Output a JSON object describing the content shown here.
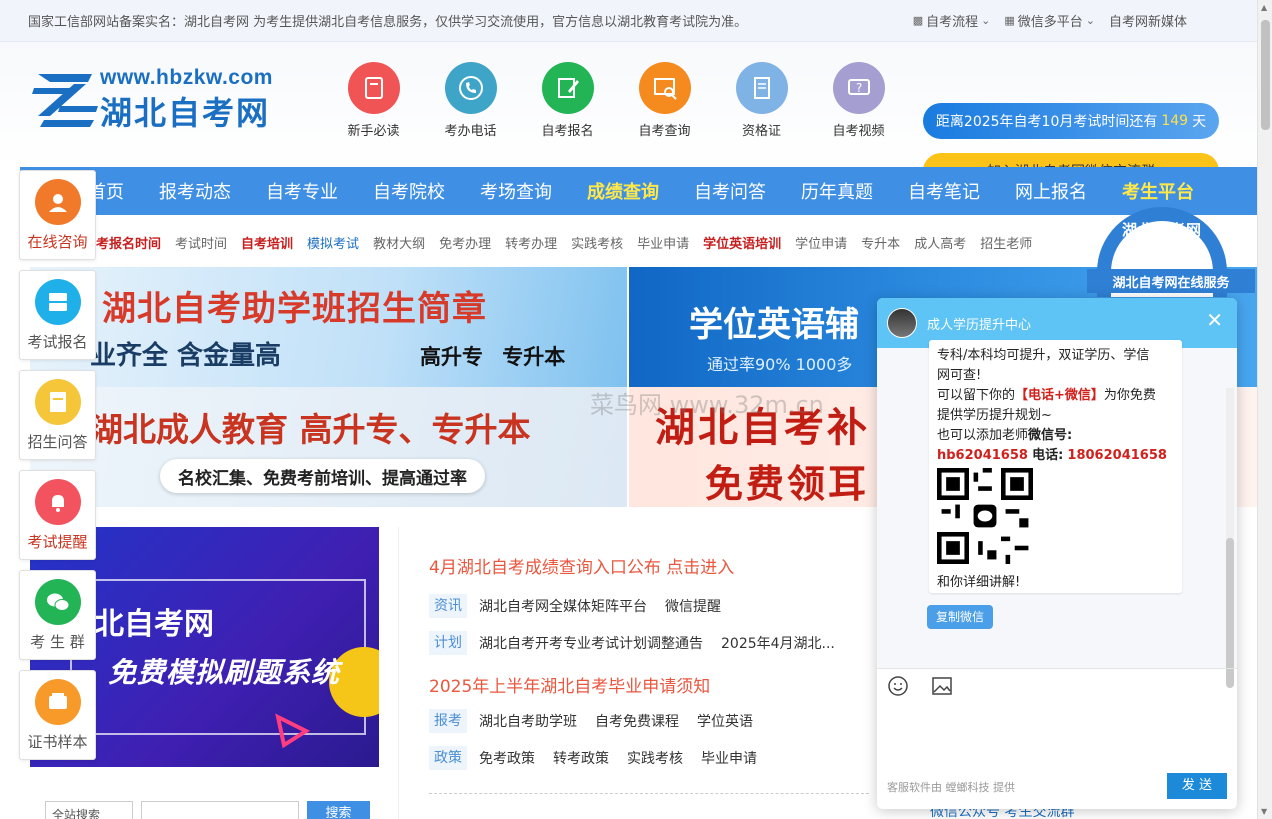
{
  "topbar": {
    "notice": "国家工信部网站备案实名：湖北自考网 为考生提供湖北自考信息服务，仅供学习交流使用，官方信息以湖北教育考试院为准。",
    "links": [
      {
        "label": "自考流程",
        "icon": "sitemap-icon",
        "has_dropdown": true
      },
      {
        "label": "微信多平台",
        "icon": "grid-icon",
        "has_dropdown": true
      },
      {
        "label": "自考网新媒体",
        "icon": "",
        "has_dropdown": false
      }
    ]
  },
  "logo": {
    "url": "www.hbzkw.com",
    "name": "湖北自考网"
  },
  "quick_links": [
    {
      "label": "新手必读",
      "icon": "book-icon",
      "color": "#f05454"
    },
    {
      "label": "考办电话",
      "icon": "phone-icon",
      "color": "#3fa5c8"
    },
    {
      "label": "自考报名",
      "icon": "edit-icon",
      "color": "#22b455"
    },
    {
      "label": "自考查询",
      "icon": "search-chart-icon",
      "color": "#f58a1f"
    },
    {
      "label": "资格证",
      "icon": "certificate-icon",
      "color": "#7fb3e6"
    },
    {
      "label": "自考视频",
      "icon": "video-chat-icon",
      "color": "#a59ed1"
    }
  ],
  "countdown": {
    "prefix": "距离2025年自考10月考试时间还有",
    "days": "149",
    "suffix": "天"
  },
  "join_button": "加入湖北自考网微信交流群",
  "nav": [
    {
      "label": "首页",
      "highlight": false
    },
    {
      "label": "报考动态",
      "highlight": false
    },
    {
      "label": "自考专业",
      "highlight": false
    },
    {
      "label": "自考院校",
      "highlight": false
    },
    {
      "label": "考场查询",
      "highlight": false
    },
    {
      "label": "成绩查询",
      "highlight": true
    },
    {
      "label": "自考问答",
      "highlight": false
    },
    {
      "label": "历年真题",
      "highlight": false
    },
    {
      "label": "自考笔记",
      "highlight": false
    },
    {
      "label": "网上报名",
      "highlight": false
    },
    {
      "label": "考生平台",
      "highlight": true
    }
  ],
  "subnav": [
    {
      "label": "考报名时间",
      "style": "red"
    },
    {
      "label": "考试时间",
      "style": ""
    },
    {
      "label": "自考培训",
      "style": "red"
    },
    {
      "label": "模拟考试",
      "style": "blue"
    },
    {
      "label": "教材大纲",
      "style": ""
    },
    {
      "label": "免考办理",
      "style": ""
    },
    {
      "label": "转考办理",
      "style": ""
    },
    {
      "label": "实践考核",
      "style": ""
    },
    {
      "label": "毕业申请",
      "style": ""
    },
    {
      "label": "学位英语培训",
      "style": "red"
    },
    {
      "label": "学位申请",
      "style": ""
    },
    {
      "label": "专升本",
      "style": ""
    },
    {
      "label": "成人高考",
      "style": ""
    },
    {
      "label": "招生老师",
      "style": ""
    }
  ],
  "banners": {
    "b1_title": "湖北自考助学班招生简章",
    "b1_sub": "业齐全 含金量高",
    "b1_tags": "高升专 专升本",
    "b2_title": "学位英语辅",
    "b2_sub": "通过率90% 1000多",
    "b3_title": "湖北成人教育 高升专、专升本",
    "b3_pill": "名校汇集、免费考前培训、提高通过率",
    "b4_line1": "湖北自考补",
    "b4_line2": "免费领耳"
  },
  "watermark": "菜鸟网 www.32m.cn",
  "promo": {
    "line1": "北自考网",
    "line2": "免费模拟刷题系统"
  },
  "news": {
    "headline1": "4月湖北自考成绩查询入口公布 点击进入",
    "row1": {
      "tag": "资讯",
      "items": [
        "湖北自考网全媒体矩阵平台",
        "微信提醒"
      ]
    },
    "row2": {
      "tag": "计划",
      "items": [
        "湖北自考开考专业考试计划调整通告",
        "2025年4月湖北..."
      ]
    },
    "headline2": "2025年上半年湖北自考毕业申请须知",
    "row3": {
      "tag": "报考",
      "items": [
        "湖北自考助学班",
        "自考免费课程",
        "学位英语"
      ]
    },
    "row4": {
      "tag": "政策",
      "items": [
        "免考政策",
        "转考政策",
        "实践考核",
        "毕业申请"
      ]
    }
  },
  "search": {
    "select_value": "全站搜索",
    "button": "搜索"
  },
  "sidebar": [
    {
      "label": "在线咨询",
      "icon": "customer-service-icon",
      "color": "#f07a2a",
      "red": true
    },
    {
      "label": "考试报名",
      "icon": "server-icon",
      "color": "#1fb0ea",
      "red": false
    },
    {
      "label": "招生问答",
      "icon": "document-icon",
      "color": "#f5c63a",
      "red": false
    },
    {
      "label": "考试提醒",
      "icon": "bell-icon",
      "color": "#f2535e",
      "red": true
    },
    {
      "label": "考 生 群",
      "icon": "wechat-icon",
      "color": "#22b455",
      "red": false
    },
    {
      "label": "证书样本",
      "icon": "certificate-icon",
      "color": "#f79a2a",
      "red": false
    }
  ],
  "seal": {
    "name": "湖北自考网",
    "caption": "湖北自考网在线服务"
  },
  "chat": {
    "title": "成人学历提升中心",
    "line_a": "专科/本科均可提升，双证学历、学信",
    "line_b": "网可查!",
    "line_c_pre": "可以留下你的",
    "line_c_red": "【电话+微信】",
    "line_c_post": "为你免费",
    "line_d": "提供学历提升规划~",
    "line_e_pre": "也可以添加老师",
    "line_e_bold": "微信号:",
    "wechat_id": "hb62041658",
    "phone_label": "电话:",
    "phone": "18062041658",
    "closing": "和你详细讲解!",
    "copy_button": "复制微信",
    "footer": "客服软件由 螳螂科技 提供",
    "send": "发 送"
  },
  "bottom_peek": "微信公众号 考生交流群"
}
